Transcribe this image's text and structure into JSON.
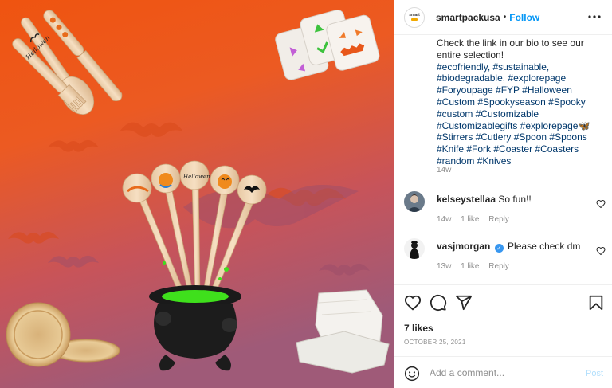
{
  "post": {
    "image_alt": "Halloween themed eco-friendly wooden cutlery, stirrers, plates and containers",
    "stirrer_labels": [
      "Hellowen",
      "Hellowen"
    ],
    "knife_label": "Hellowen"
  },
  "header": {
    "avatar_text": "smart",
    "username": "smartpackusa",
    "separator": "•",
    "follow_label": "Follow",
    "more_label": "•••"
  },
  "caption": {
    "text": "Check the link in our bio to see our entire selection!",
    "hashtags": "#ecofriendly, #sustainable, #biodegradable, #explorepage #Foryoupage #FYP #Halloween #Custom #Spookyseason #Spooky #custom #Customizable #Customizablegifts #explorepage🦋#Stirrers #Cutlery #Spoon #Spoons #Knife #Fork #Coaster #Coasters #random #Knives",
    "time": "14w"
  },
  "comments": [
    {
      "username": "kelseystellaa",
      "text": "So fun!!",
      "time": "14w",
      "likes": "1 like",
      "reply": "Reply",
      "verified": false
    },
    {
      "username": "vasjmorgan",
      "text": "Please check dm",
      "time": "13w",
      "likes": "1 like",
      "reply": "Reply",
      "verified": true,
      "verified_mark": "✓"
    }
  ],
  "actions": {
    "likes_count": "7 likes",
    "date": "OCTOBER 25, 2021"
  },
  "add_comment": {
    "placeholder": "Add a comment...",
    "post_label": "Post"
  },
  "colors": {
    "follow": "#0095f6",
    "hashtag": "#00376b",
    "muted": "#8e8e8e",
    "post_disabled": "#b2dffc",
    "verified": "#3897f0",
    "bg_top": "#ef5a14",
    "bg_bottom": "#a4576f"
  },
  "icons": [
    "heart-icon",
    "comment-icon",
    "share-icon",
    "bookmark-icon",
    "emoji-icon",
    "more-icon",
    "verified-icon"
  ]
}
